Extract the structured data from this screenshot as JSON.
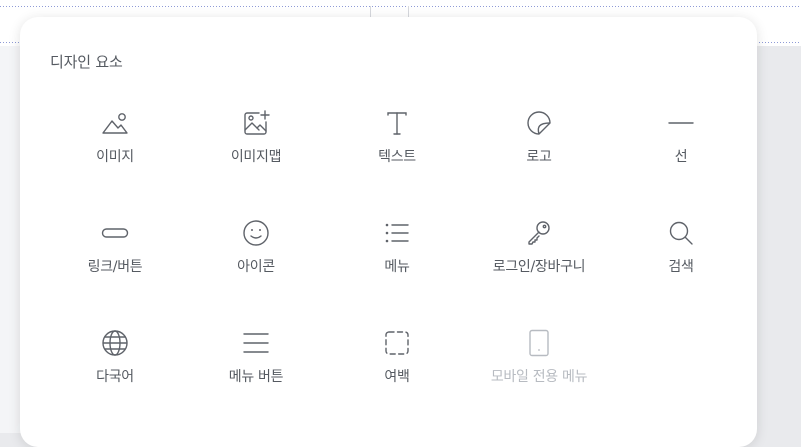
{
  "panel": {
    "title": "디자인 요소",
    "items": [
      {
        "label": "이미지",
        "icon": "image-mountain-icon",
        "enabled": true
      },
      {
        "label": "이미지맵",
        "icon": "image-plus-icon",
        "enabled": true
      },
      {
        "label": "텍스트",
        "icon": "text-t-icon",
        "enabled": true
      },
      {
        "label": "로고",
        "icon": "logo-sticker-icon",
        "enabled": true
      },
      {
        "label": "선",
        "icon": "line-icon",
        "enabled": true
      },
      {
        "label": "링크/버튼",
        "icon": "pill-button-icon",
        "enabled": true
      },
      {
        "label": "아이콘",
        "icon": "smiley-icon",
        "enabled": true
      },
      {
        "label": "메뉴",
        "icon": "list-icon",
        "enabled": true
      },
      {
        "label": "로그인/장바구니",
        "icon": "key-icon",
        "enabled": true
      },
      {
        "label": "검색",
        "icon": "search-icon",
        "enabled": true
      },
      {
        "label": "다국어",
        "icon": "globe-icon",
        "enabled": true
      },
      {
        "label": "메뉴 버튼",
        "icon": "hamburger-icon",
        "enabled": true
      },
      {
        "label": "여백",
        "icon": "dashed-square-icon",
        "enabled": true
      },
      {
        "label": "모바일 전용 메뉴",
        "icon": "mobile-icon",
        "enabled": false
      }
    ]
  }
}
